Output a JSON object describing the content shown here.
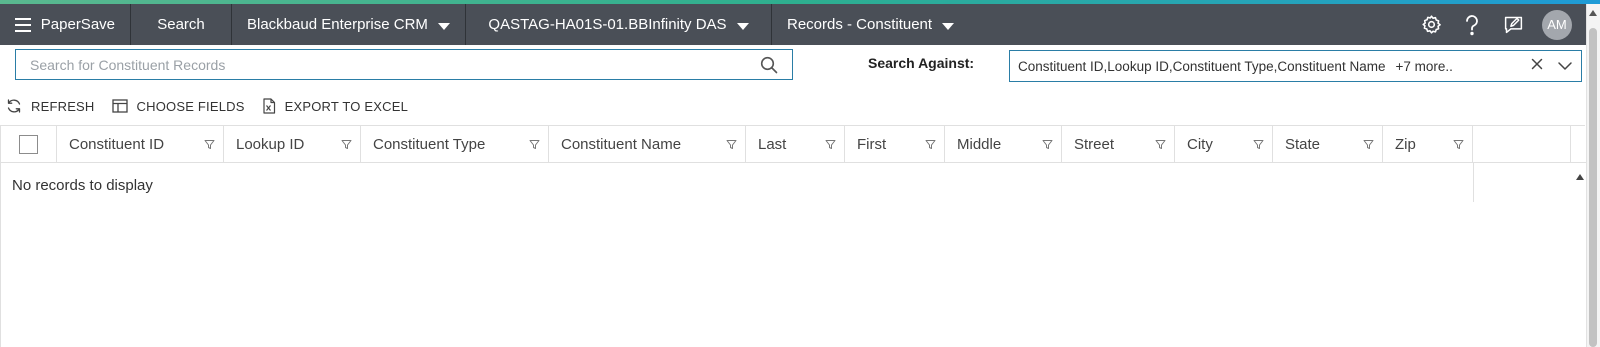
{
  "topbar": {
    "app_name": "PaperSave",
    "search_label": "Search",
    "crm_label": "Blackbaud Enterprise CRM",
    "database_label": "QASTAG-HA01S-01.BBInfinity DAS",
    "records_label": "Records - Constituent",
    "avatar_initials": "AM",
    "icons": [
      "menu-icon",
      "gear-icon",
      "help-icon",
      "feedback-icon"
    ]
  },
  "search": {
    "placeholder": "Search for Constituent Records",
    "value": "",
    "against_label": "Search Against:",
    "against_value": "Constituent ID,Lookup ID,Constituent Type,Constituent Name",
    "against_more": "+7 more.."
  },
  "toolbar": {
    "refresh_label": "REFRESH",
    "choose_fields_label": "CHOOSE FIELDS",
    "export_label": "EXPORT TO EXCEL"
  },
  "grid": {
    "columns": [
      "Constituent ID",
      "Lookup ID",
      "Constituent Type",
      "Constituent Name",
      "Last",
      "First",
      "Middle",
      "Street",
      "City",
      "State",
      "Zip"
    ],
    "rows": [],
    "empty_message": "No records to display"
  },
  "colors": {
    "topbar_bg": "#4a4f57",
    "accent_border": "#2a7da6"
  }
}
